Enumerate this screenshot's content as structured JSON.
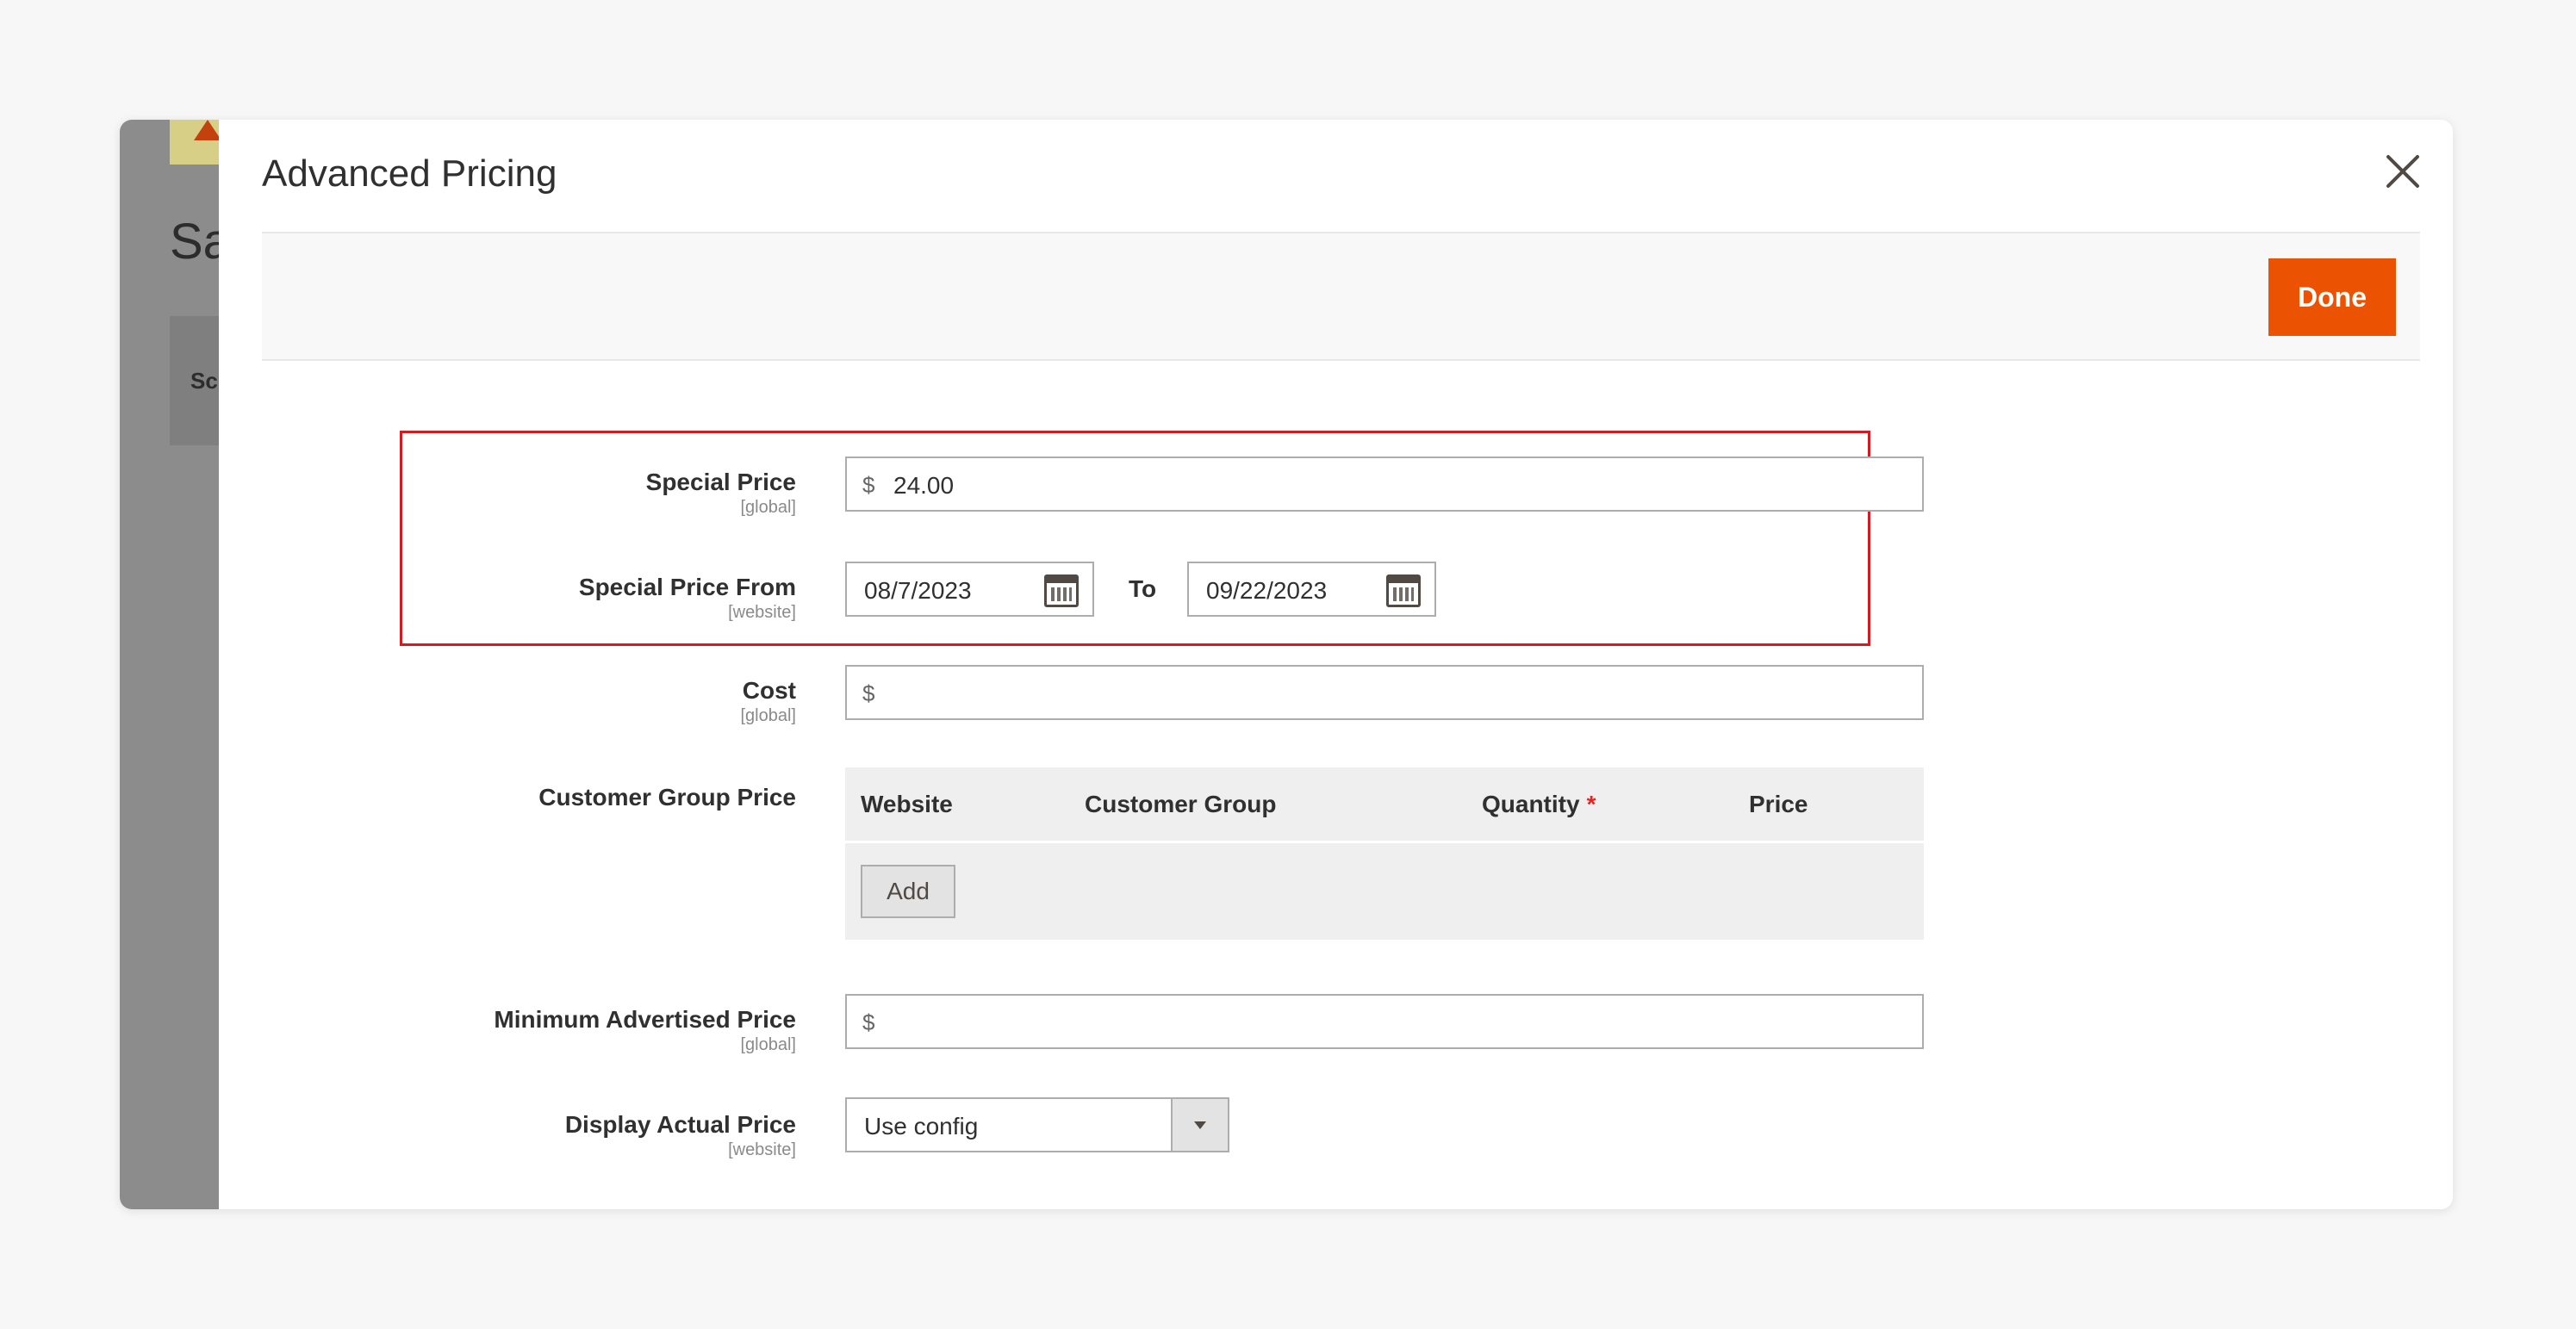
{
  "background": {
    "title_fragment": "Sa",
    "tab_fragment": "Sc"
  },
  "modal": {
    "title": "Advanced Pricing",
    "done_label": "Done"
  },
  "fields": {
    "special_price": {
      "label": "Special Price",
      "scope": "[global]",
      "currency": "$",
      "value": "24.00"
    },
    "special_price_from": {
      "label": "Special Price From",
      "scope": "[website]",
      "from": "08/7/2023",
      "to_label": "To",
      "to": "09/22/2023"
    },
    "cost": {
      "label": "Cost",
      "scope": "[global]",
      "currency": "$",
      "value": ""
    },
    "customer_group_price": {
      "label": "Customer Group Price",
      "columns": [
        "Website",
        "Customer Group",
        "Quantity",
        "Price"
      ],
      "required_marker": "*",
      "add_label": "Add"
    },
    "minimum_advertised_price": {
      "label": "Minimum Advertised Price",
      "scope": "[global]",
      "currency": "$",
      "value": ""
    },
    "display_actual_price": {
      "label": "Display Actual Price",
      "scope": "[website]",
      "selected": "Use config"
    }
  },
  "colors": {
    "accent": "#eb5202",
    "highlight_border": "#d71920",
    "required": "#e22626"
  }
}
